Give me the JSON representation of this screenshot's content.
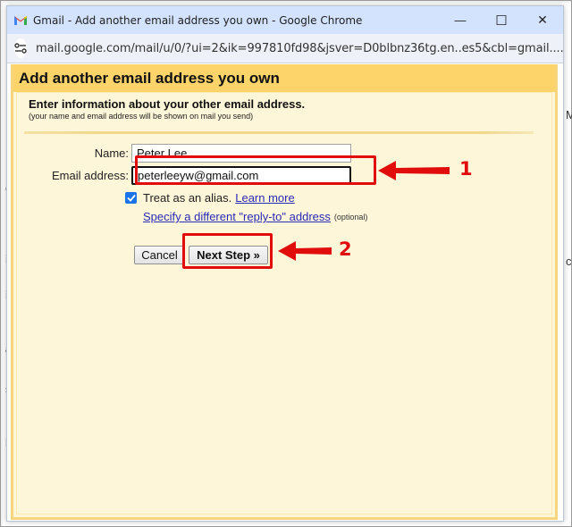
{
  "window": {
    "title": "Gmail - Add another email address you own - Google Chrome",
    "url": "mail.google.com/mail/u/0/?ui=2&ik=997810fd98&jsver=D0blbnz36tg.en..es5&cbl=gmail....",
    "controls": {
      "minimize": "—",
      "maximize": "☐",
      "close": "✕"
    }
  },
  "dialog": {
    "title": "Add another email address you own",
    "info_title": "Enter information about your other email address.",
    "info_subtitle": "(your name and email address will be shown on mail you send)",
    "form": {
      "name_label": "Name:",
      "name_value": "Peter Lee",
      "email_label": "Email address:",
      "email_value": "peterleeyw@gmail.com",
      "alias_checked": true,
      "alias_label": "Treat as an alias.",
      "learn_more": "Learn more",
      "reply_to_link": "Specify a different \"reply-to\" address",
      "optional_label": "(optional)"
    },
    "buttons": {
      "cancel": "Cancel",
      "next": "Next Step »"
    }
  },
  "annotations": {
    "step1": "1",
    "step2": "2",
    "color": "#e10d0d"
  }
}
